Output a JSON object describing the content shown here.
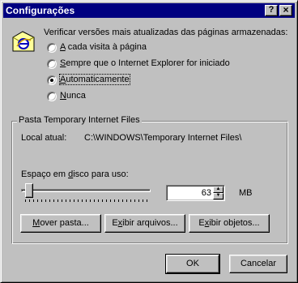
{
  "window": {
    "title": "Configurações",
    "help_button": "?",
    "close_button": "×"
  },
  "check_section": {
    "heading": "Verificar versões mais atualizadas das páginas armazenadas:",
    "options": [
      {
        "label": "A cada visita à página",
        "checked": false
      },
      {
        "label": "Sempre que o Internet Explorer for iniciado",
        "checked": false
      },
      {
        "label": "Automaticamente",
        "checked": true
      },
      {
        "label": "Nunca",
        "checked": false
      }
    ]
  },
  "temp_files": {
    "group_title": "Pasta Temporary Internet Files",
    "location_label": "Local atual:",
    "location_value": "C:\\WINDOWS\\Temporary Internet Files\\",
    "disk_space_label": "Espaço em disco para uso:",
    "disk_space_value": "63",
    "disk_space_unit": "MB",
    "disk_space_slider_fraction": 0.02,
    "buttons": {
      "move": "Mover pasta...",
      "view_files": "Exibir arquivos...",
      "view_objects": "Exibir objetos..."
    }
  },
  "footer": {
    "ok": "OK",
    "cancel": "Cancelar"
  },
  "icons": {
    "ie_page": "internet-explorer-page-icon"
  }
}
